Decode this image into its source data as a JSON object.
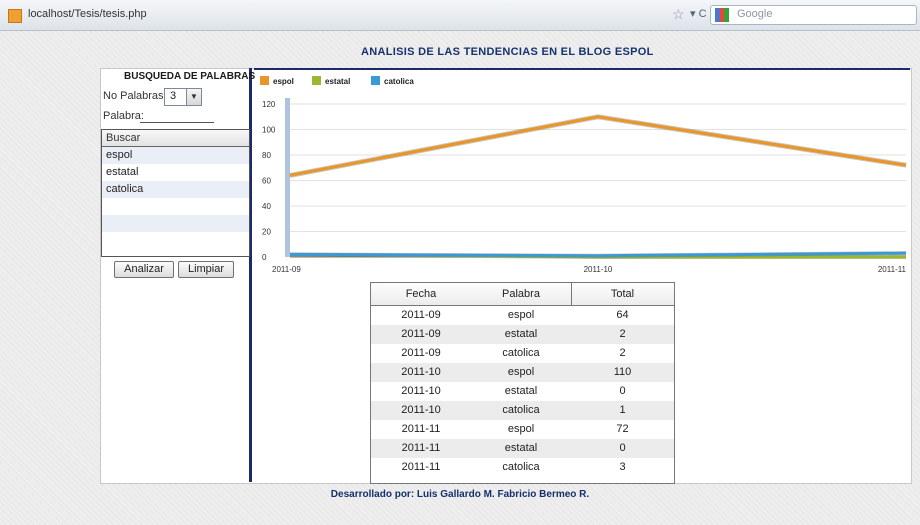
{
  "browser": {
    "url": "localhost/Tesis/tesis.php",
    "search_placeholder": "Google"
  },
  "page": {
    "title": "ANALISIS DE LAS TENDENCIAS EN EL BLOG ESPOL",
    "footer": "Desarrollado por: Luis Gallardo M.   Fabricio Bermeo R."
  },
  "search": {
    "title": "BUSQUEDA DE PALABRAS",
    "count_label": "No Palabras:",
    "count_value": "3",
    "word_label": "Palabra:",
    "word_value": "",
    "list_header": "Buscar",
    "words": [
      "espol",
      "estatal",
      "catolica"
    ],
    "analyze_button": "Analizar",
    "clear_button": "Limpiar"
  },
  "chart_data": {
    "type": "line",
    "x": [
      "2011-09",
      "2011-10",
      "2011-11"
    ],
    "series": [
      {
        "name": "espol",
        "values": [
          64,
          110,
          72
        ],
        "color": "#e8952a"
      },
      {
        "name": "estatal",
        "values": [
          2,
          0,
          0
        ],
        "color": "#9ab830"
      },
      {
        "name": "catolica",
        "values": [
          2,
          1,
          3
        ],
        "color": "#3a9ad8"
      }
    ],
    "yticks": [
      0,
      20,
      40,
      60,
      80,
      100,
      120
    ],
    "ylim": [
      0,
      120
    ],
    "legend": "top-left",
    "grid": true
  },
  "table": {
    "headers": [
      "Fecha",
      "Palabra",
      "Total"
    ],
    "rows": [
      [
        "2011-09",
        "espol",
        "64"
      ],
      [
        "2011-09",
        "estatal",
        "2"
      ],
      [
        "2011-09",
        "catolica",
        "2"
      ],
      [
        "2011-10",
        "espol",
        "110"
      ],
      [
        "2011-10",
        "estatal",
        "0"
      ],
      [
        "2011-10",
        "catolica",
        "1"
      ],
      [
        "2011-11",
        "espol",
        "72"
      ],
      [
        "2011-11",
        "estatal",
        "0"
      ],
      [
        "2011-11",
        "catolica",
        "3"
      ]
    ]
  }
}
